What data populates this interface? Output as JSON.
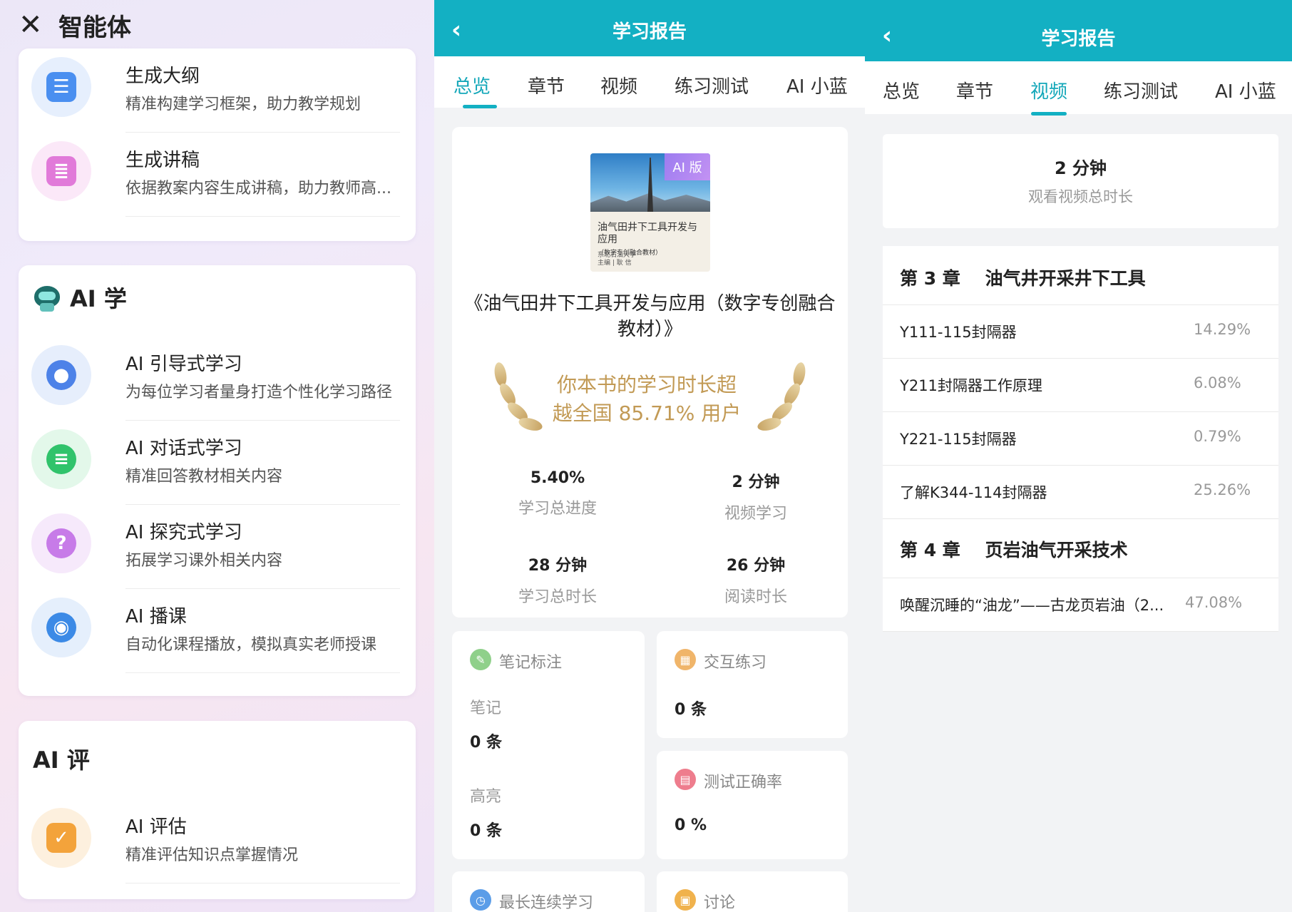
{
  "panel1": {
    "title": "智能体",
    "section1_items": [
      {
        "name": "生成大纲",
        "desc": "精准构建学习框架，助力教学规划",
        "icon": "outline-list-icon",
        "color": "#4a8ff0",
        "bg": "#e6effd"
      },
      {
        "name": "生成讲稿",
        "desc": "依据教案内容生成讲稿，助力教师高...",
        "icon": "script-document-icon",
        "color": "#e17ad9",
        "bg": "#fbe8f8"
      }
    ],
    "section2_title": "AI 学",
    "section2_items": [
      {
        "name": "AI 引导式学习",
        "desc": "为每位学习者量身打造个性化学习路径",
        "icon": "person-icon",
        "color": "#4d82e8",
        "bg": "#e6eefc"
      },
      {
        "name": "AI 对话式学习",
        "desc": "精准回答教材相关内容",
        "icon": "chat-bubble-icon",
        "color": "#30c36b",
        "bg": "#e3f8ea"
      },
      {
        "name": "AI 探究式学习",
        "desc": "拓展学习课外相关内容",
        "icon": "question-explore-icon",
        "color": "#c77be8",
        "bg": "#f6e9fb"
      },
      {
        "name": "AI 播课",
        "desc": "自动化课程播放，模拟真实老师授课",
        "icon": "podcast-broadcast-icon",
        "color": "#3c8ae6",
        "bg": "#e5effc"
      }
    ],
    "section3_title": "AI 评",
    "section3_items": [
      {
        "name": "AI 评估",
        "desc": "精准评估知识点掌握情况",
        "icon": "assessment-clipboard-icon",
        "color": "#f3a33b",
        "bg": "#fdf0de"
      }
    ]
  },
  "panel2": {
    "title": "学习报告",
    "tabs": [
      "总览",
      "章节",
      "视频",
      "练习测试",
      "AI 小蓝"
    ],
    "active_tab": "总览",
    "cover": {
      "badge": "AI 版",
      "title": "油气田井下工具开发与应用",
      "subtitle": "（数字专创融合教材）",
      "publisher": "东北石油大学",
      "editor": "主编 | 耿    信"
    },
    "book_title": "《油气田井下工具开发与应用（数字专创融合教材）》",
    "rank_text_line1": "你本书的学习时长超",
    "rank_text_line2": "越全国 85.71% 用户",
    "stats": [
      {
        "value": "5.40%",
        "label": "学习总进度"
      },
      {
        "value": "2 分钟",
        "label": "视频学习"
      },
      {
        "value": "28 分钟",
        "label": "学习总时长"
      },
      {
        "value": "26 分钟",
        "label": "阅读时长"
      }
    ],
    "notes": {
      "title": "笔记标注",
      "note_label": "笔记",
      "note_value": "0 条",
      "highlight_label": "高亮",
      "highlight_value": "0 条"
    },
    "practice": {
      "title": "交互练习",
      "value": "0 条"
    },
    "test": {
      "title": "测试正确率",
      "value": "0 %"
    },
    "streak": {
      "title": "最长连续学习"
    },
    "discussion": {
      "title": "讨论"
    },
    "colors": {
      "accent": "#13b0c3",
      "gold": "#c29a55"
    }
  },
  "panel3": {
    "title": "学习报告",
    "tabs": [
      "总览",
      "章节",
      "视频",
      "练习测试",
      "AI 小蓝"
    ],
    "active_tab": "视频",
    "summary_value": "2 分钟",
    "summary_label": "观看视频总时长",
    "chapters": [
      {
        "title": "第 3 章    油气井开采井下工具",
        "videos": [
          {
            "name": "Y111-115封隔器",
            "percent": "14.29%"
          },
          {
            "name": "Y211封隔器工作原理",
            "percent": "6.08%"
          },
          {
            "name": "Y221-115封隔器",
            "percent": "0.79%"
          },
          {
            "name": "了解K344-114封隔器",
            "percent": "25.26%"
          }
        ]
      },
      {
        "title": "第 4 章    页岩油气开采技术",
        "videos": [
          {
            "name": "唤醒沉睡的“油龙”——古龙页岩油（2...",
            "percent": "47.08%"
          }
        ]
      }
    ]
  }
}
